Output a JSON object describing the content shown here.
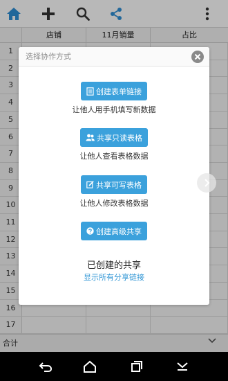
{
  "colors": {
    "accent": "#3ba1dc",
    "link": "#3598d6",
    "toolbar_icon": "#2f8fd6"
  },
  "toolbar": {
    "icons": [
      "home-icon",
      "add-icon",
      "search-icon",
      "share-icon",
      "more-icon"
    ]
  },
  "sheet": {
    "columns": [
      "店铺",
      "11月销量",
      "占比"
    ],
    "row_numbers": [
      "1",
      "2",
      "3",
      "4",
      "5",
      "6",
      "7",
      "8",
      "9",
      "10",
      "11",
      "12",
      "13",
      "14",
      "15",
      "16",
      "17"
    ],
    "total_label": "合计"
  },
  "dialog": {
    "title": "选择协作方式",
    "actions": [
      {
        "label": "创建表单链接",
        "desc": "让他人用手机填写新数据",
        "icon": "form-icon"
      },
      {
        "label": "共享只读表格",
        "desc": "让他人查看表格数据",
        "icon": "users-icon"
      },
      {
        "label": "共享可写表格",
        "desc": "让他人修改表格数据",
        "icon": "edit-icon"
      },
      {
        "label": "创建高级共享",
        "desc": "",
        "icon": "question-icon"
      }
    ],
    "created_heading": "已创建的共享",
    "show_all_link": "显示所有分享链接"
  },
  "navbar": {
    "icons": [
      "back-icon",
      "home-icon",
      "recent-apps-icon",
      "hide-keyboard-icon"
    ]
  }
}
